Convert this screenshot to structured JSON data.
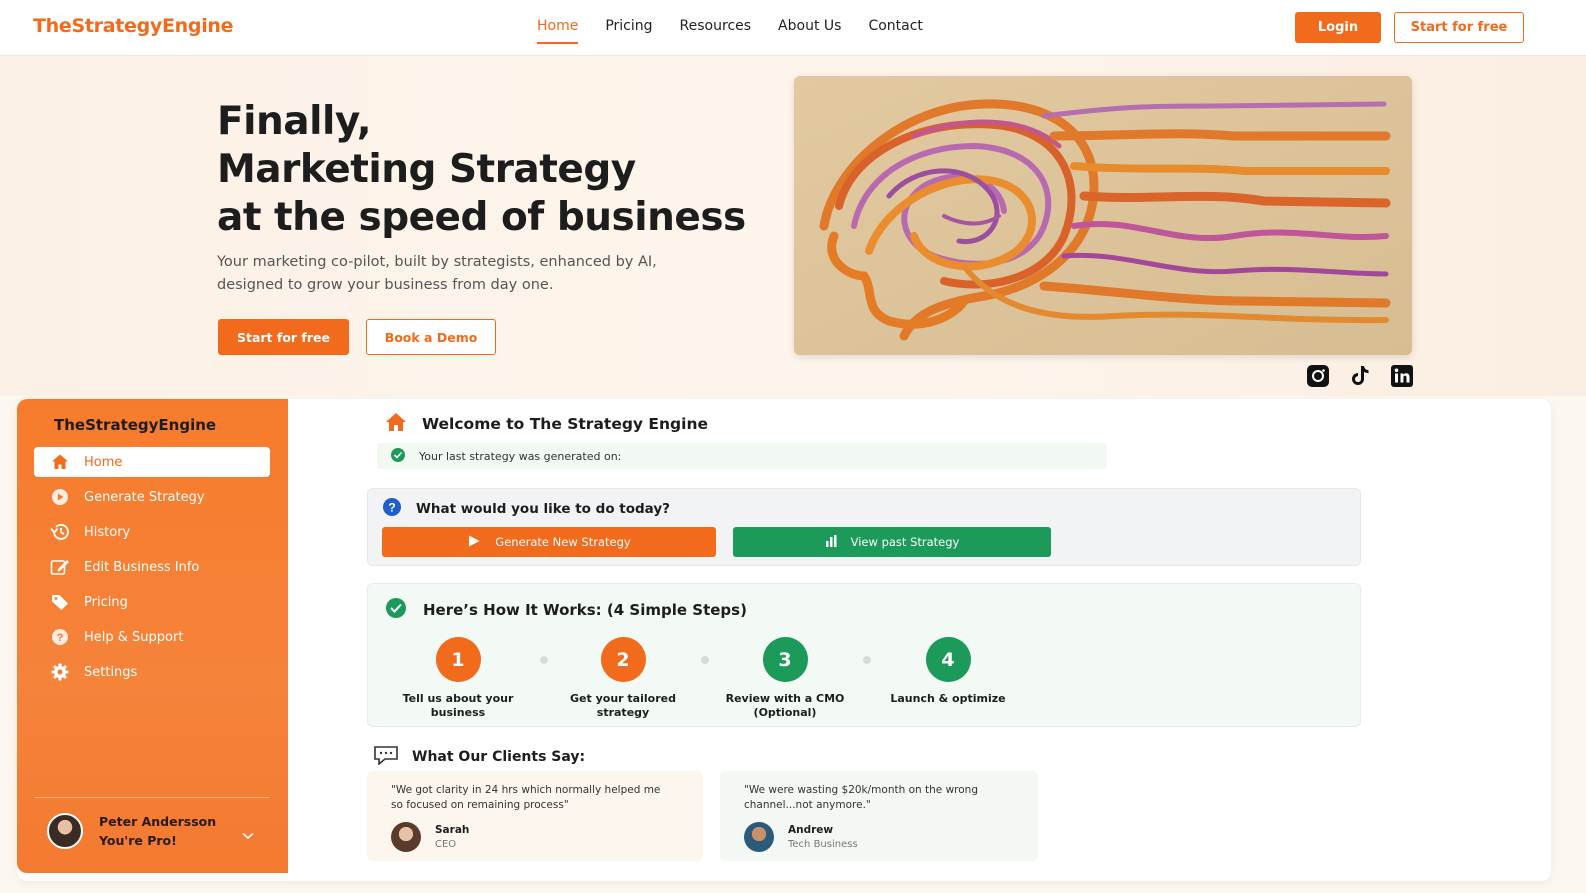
{
  "header": {
    "logo": "TheStrategyEngine",
    "nav": [
      "Home",
      "Pricing",
      "Resources",
      "About Us",
      "Contact"
    ],
    "login_label": "Login",
    "start_label": "Start for free"
  },
  "hero": {
    "headline_1": "Finally,",
    "headline_2": "Marketing Strategy",
    "headline_3": "at the speed of business",
    "subline_1": "Your marketing co-pilot, built by strategists, enhanced by AI,",
    "subline_2": "designed to grow your business from day one.",
    "start_label": "Start for free",
    "demo_label": "Book a Demo"
  },
  "socials": [
    "instagram-icon",
    "tiktok-icon",
    "linkedin-icon"
  ],
  "sidebar": {
    "title": "TheStrategyEngine",
    "items": [
      {
        "label": "Home",
        "icon": "home-icon"
      },
      {
        "label": "Generate Strategy",
        "icon": "play-icon"
      },
      {
        "label": "History",
        "icon": "history-icon"
      },
      {
        "label": "Edit Business Info",
        "icon": "edit-icon"
      },
      {
        "label": "Pricing",
        "icon": "tag-icon"
      },
      {
        "label": "Help & Support",
        "icon": "help-icon"
      },
      {
        "label": "Settings",
        "icon": "gear-icon"
      }
    ],
    "user": {
      "name": "Peter Andersson",
      "status": "You're Pro!"
    }
  },
  "main": {
    "welcome": "Welcome to The Strategy Engine",
    "last_strategy": "Your last strategy was generated on:",
    "question": "What would you like to do today?",
    "generate_label": "Generate New Strategy",
    "past_label": "View past Strategy",
    "steps_title": "Here’s How It Works: (4 Simple Steps)",
    "steps": [
      {
        "num": "1",
        "label_1": "Tell us about your",
        "label_2": "business"
      },
      {
        "num": "2",
        "label_1": "Get your tailored",
        "label_2": "strategy"
      },
      {
        "num": "3",
        "label_1": "Review with a CMO",
        "label_2": "(Optional)"
      },
      {
        "num": "4",
        "label_1": "Launch & optimize",
        "label_2": ""
      }
    ],
    "clients_title": "What Our Clients Say:",
    "testimonials": [
      {
        "quote_1": "\"We got clarity in 24 hrs which normally helped me",
        "quote_2": "so focused on remaining process\"",
        "name": "Sarah",
        "role": "CEO"
      },
      {
        "quote_1": "\"We were wasting $20k/month on the wrong",
        "quote_2": "channel...not anymore.\"",
        "name": "Andrew",
        "role": "Tech Business"
      }
    ]
  },
  "colors": {
    "brand_orange": "#f26a1b",
    "brand_green": "#1b9a5a"
  }
}
